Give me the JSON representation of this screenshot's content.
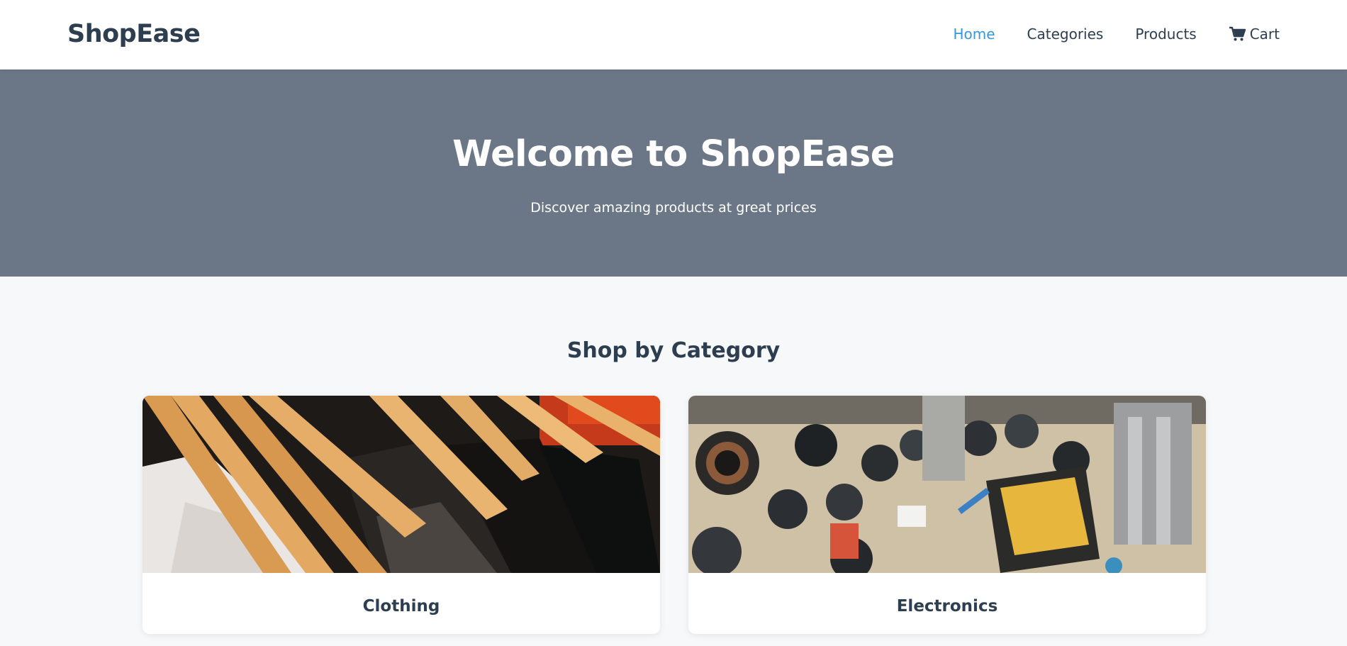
{
  "header": {
    "logo": "ShopEase",
    "nav": [
      {
        "label": "Home",
        "active": true
      },
      {
        "label": "Categories",
        "active": false
      },
      {
        "label": "Products",
        "active": false
      },
      {
        "label": "Cart",
        "active": false,
        "icon": "cart-icon"
      }
    ]
  },
  "hero": {
    "title": "Welcome to ShopEase",
    "subtitle": "Discover amazing products at great prices"
  },
  "categories": {
    "title": "Shop by Category",
    "items": [
      {
        "label": "Clothing",
        "image": "clothing-hangers-photo"
      },
      {
        "label": "Electronics",
        "image": "circuit-board-photo"
      }
    ]
  },
  "colors": {
    "primary": "#2c3e50",
    "accent": "#3498db",
    "hero_bg": "#6b7787",
    "page_bg": "#f6f8fa"
  }
}
